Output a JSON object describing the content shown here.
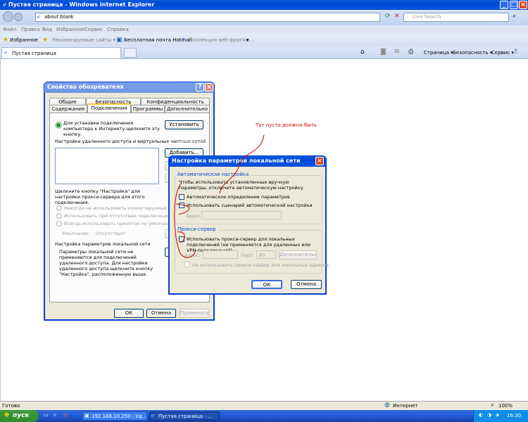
{
  "window": {
    "title": "Пустая страница - Windows Internet Explorer"
  },
  "address_bar": {
    "url": "about:blank"
  },
  "search": {
    "placeholder": "Live Search"
  },
  "menu": [
    "Файл",
    "Правка",
    "Вид",
    "Избранное",
    "Сервис",
    "Справка"
  ],
  "favorites_bar": {
    "favorites": "Избранное",
    "suggested": "Рекомендуемые сайты ▾",
    "hotmail": "Бесплатная почта Hotmail",
    "webslices": "Коллекция веб-фрагме..."
  },
  "tab": {
    "label": "Пустая страница"
  },
  "command_bar": {
    "page": "Страница ▾",
    "safety": "Безопасность ▾",
    "tools": "Сервис ▾"
  },
  "annotation": {
    "text": "Тут пусто должно быть",
    "color": "#cc0000"
  },
  "inet_props": {
    "title": "Свойства обозревателя",
    "tabs_row1": [
      "Общие",
      "Безопасность",
      "Конфиденциальность"
    ],
    "tabs_row2": [
      "Содержание",
      "Подключения",
      "Программы",
      "Дополнительно"
    ],
    "setup_text": "Для установки подключения компьютера к Интернету щелкните эту кнопку.",
    "setup_button": "Установить",
    "dialup_label": "Настройка удаленного доступа и виртуальных частных сетей",
    "add_button": "Добавить...",
    "settings_hint": "Щелкните кнопку \"Настройка\" для настройки прокси-сервера для этого подключения.",
    "radio_never": "Никогда не использовать коммутируемые подкл",
    "radio_absent": "Использовать при отсутствии подключения к сети",
    "radio_always": "Всегда использовать принятое по умолчанию подкл",
    "default_label": "Умолчание:",
    "default_value": "Отсутствует",
    "lan_label": "Настройка параметров локальной сети",
    "lan_text": "Параметры локальной сети не применяются для подключений удаленного доступа. Для настройки удаленного доступа щелкните кнопку \"Настройка\", расположенную выше.",
    "ok": "ОК",
    "cancel": "Отмена",
    "apply": "Применить"
  },
  "lan_dialog": {
    "title": "Настройка параметров локальной сети",
    "auto_group": "Автоматическая настройка",
    "auto_desc": "Чтобы использовать установленные вручную параметры, отключите автоматическую настройку.",
    "auto_detect": "Автоматическое определение параметров",
    "auto_script": "Использовать сценарий автоматической настройки",
    "address_label": "Адрес",
    "proxy_group": "Прокси-сервер",
    "proxy_use": "Использовать прокси-сервер для локальных подключений (не применяется для удаленных или VPN-подключений).",
    "proxy_address_label": "Адрес:",
    "port_label": "Порт:",
    "port_value": "80",
    "advanced": "Дополнительно",
    "bypass": "Не использовать прокси-сервер для локальных адресов",
    "ok": "ОК",
    "cancel": "Отмена"
  },
  "statusbar": {
    "left": "Готово",
    "zone": "Интернет",
    "zoom": "100%"
  },
  "taskbar": {
    "start": "пуск",
    "tasks": [
      "192.168.10.250 - Уд...",
      "Пустая страница - ..."
    ],
    "clock": "16:30"
  }
}
